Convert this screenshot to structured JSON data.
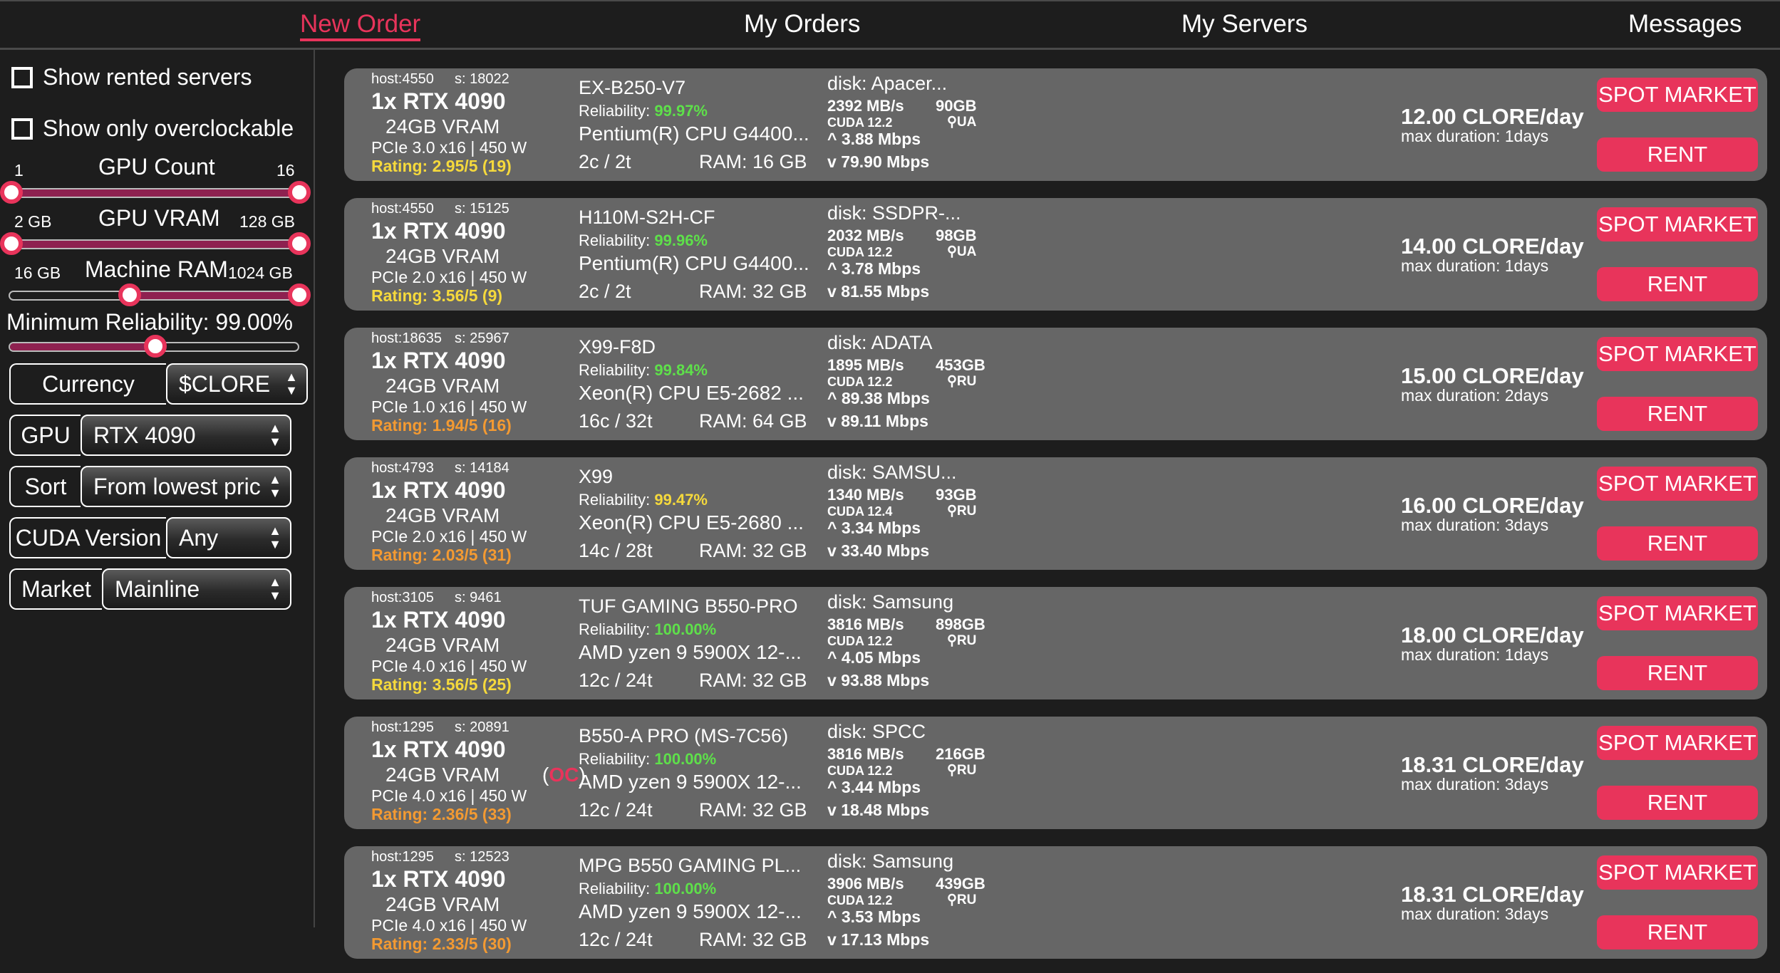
{
  "nav": {
    "items": [
      {
        "label": "New Order",
        "active": true
      },
      {
        "label": "My Orders"
      },
      {
        "label": "My Servers"
      },
      {
        "label": "Messages"
      }
    ]
  },
  "colors": {
    "accent": "#e8345b",
    "card": "#666666",
    "background": "#1d1d1d",
    "green": "#5ee04a",
    "yellow": "#f5d93c",
    "orange": "#f39a32"
  },
  "filters": {
    "show_rented": {
      "label": "Show rented servers",
      "checked": false
    },
    "show_overclockable": {
      "label": "Show only overclockable",
      "checked": false
    },
    "gpu_count": {
      "label": "GPU Count",
      "min_label": "1",
      "max_label": "16",
      "low_fraction": 0,
      "high_fraction": 1
    },
    "gpu_vram": {
      "label": "GPU VRAM",
      "min_label": "2 GB",
      "max_label": "128 GB",
      "low_fraction": 0,
      "high_fraction": 1
    },
    "machine_ram": {
      "label": "Machine RAM",
      "min_label": "16 GB",
      "max_label": "1024 GB",
      "low_fraction": 0.41,
      "high_fraction": 1
    },
    "min_reliability": {
      "label": "Minimum Reliability: 99.00%",
      "fraction": 0.5
    },
    "currency": {
      "label": "Currency",
      "value": "$CLORE"
    },
    "gpu": {
      "label": "GPU",
      "value": "RTX 4090"
    },
    "sort": {
      "label": "Sort",
      "value": "From lowest pric"
    },
    "cuda": {
      "label": "CUDA Version",
      "value": "Any"
    },
    "market": {
      "label": "Market",
      "value": "Mainline"
    }
  },
  "buttons": {
    "spot": "SPOT MARKET",
    "rent": "RENT"
  },
  "servers": [
    {
      "host": "host:4550",
      "s": "s: 18022",
      "gpu": "1x RTX 4090",
      "vram": "24GB VRAM",
      "oc": false,
      "pcie": "PCIe 3.0 x16 | 450 W",
      "rating": "Rating: 2.95/5 (19)",
      "rating_color": "yellow",
      "mb": "EX-B250-V7",
      "reliability": "99.97%",
      "rel_color": "green",
      "cpu": "Pentium(R) CPU G4400...",
      "cores": "2c / 2t",
      "ram": "RAM: 16 GB",
      "disk": "disk: Apacer...",
      "disk_speed": "2392 MB/s",
      "disk_size": "90GB",
      "cuda": "CUDA 12.2",
      "country": "UA",
      "up": "3.88 Mbps",
      "down": "79.90 Mbps",
      "price": "12.00 CLORE/day",
      "duration": "max duration: 1days"
    },
    {
      "host": "host:4550",
      "s": "s: 15125",
      "gpu": "1x RTX 4090",
      "vram": "24GB VRAM",
      "oc": false,
      "pcie": "PCIe 2.0 x16 | 450 W",
      "rating": "Rating: 3.56/5 (9)",
      "rating_color": "yellow",
      "mb": "H110M-S2H-CF",
      "reliability": "99.96%",
      "rel_color": "green",
      "cpu": "Pentium(R) CPU G4400...",
      "cores": "2c / 2t",
      "ram": "RAM: 32 GB",
      "disk": "disk: SSDPR-...",
      "disk_speed": "2032 MB/s",
      "disk_size": "98GB",
      "cuda": "CUDA 12.2",
      "country": "UA",
      "up": "3.78 Mbps",
      "down": "81.55 Mbps",
      "price": "14.00 CLORE/day",
      "duration": "max duration: 1days"
    },
    {
      "host": "host:18635",
      "s": "s: 25967",
      "gpu": "1x RTX 4090",
      "vram": "24GB VRAM",
      "oc": false,
      "pcie": "PCIe 1.0 x16 | 450 W",
      "rating": "Rating: 1.94/5 (16)",
      "rating_color": "orange",
      "mb": "X99-F8D",
      "reliability": "99.84%",
      "rel_color": "green",
      "cpu": "Xeon(R) CPU E5-2682 ...",
      "cores": "16c / 32t",
      "ram": "RAM: 64 GB",
      "disk": "disk: ADATA",
      "disk_speed": "1895 MB/s",
      "disk_size": "453GB",
      "cuda": "CUDA 12.2",
      "country": "RU",
      "up": "89.38 Mbps",
      "down": "89.11 Mbps",
      "price": "15.00 CLORE/day",
      "duration": "max duration: 2days"
    },
    {
      "host": "host:4793",
      "s": "s: 14184",
      "gpu": "1x RTX 4090",
      "vram": "24GB VRAM",
      "oc": false,
      "pcie": "PCIe 2.0 x16 | 450 W",
      "rating": "Rating: 2.03/5 (31)",
      "rating_color": "orange",
      "mb": "X99",
      "reliability": "99.47%",
      "rel_color": "yellow",
      "cpu": "Xeon(R) CPU E5-2680 ...",
      "cores": "14c / 28t",
      "ram": "RAM: 32 GB",
      "disk": "disk: SAMSU...",
      "disk_speed": "1340 MB/s",
      "disk_size": "93GB",
      "cuda": "CUDA 12.4",
      "country": "RU",
      "up": "3.34 Mbps",
      "down": "33.40 Mbps",
      "price": "16.00 CLORE/day",
      "duration": "max duration: 3days"
    },
    {
      "host": "host:3105",
      "s": "s: 9461",
      "gpu": "1x RTX 4090",
      "vram": "24GB VRAM",
      "oc": false,
      "pcie": "PCIe 4.0 x16 | 450 W",
      "rating": "Rating: 3.56/5 (25)",
      "rating_color": "yellow",
      "mb": "TUF GAMING B550-PRO",
      "reliability": "100.00%",
      "rel_color": "green",
      "cpu": "AMD yzen 9 5900X 12-...",
      "cores": "12c / 24t",
      "ram": "RAM: 32 GB",
      "disk": "disk: Samsung",
      "disk_speed": "3816 MB/s",
      "disk_size": "898GB",
      "cuda": "CUDA 12.2",
      "country": "RU",
      "up": "4.05 Mbps",
      "down": "93.88 Mbps",
      "price": "18.00 CLORE/day",
      "duration": "max duration: 1days"
    },
    {
      "host": "host:1295",
      "s": "s: 20891",
      "gpu": "1x RTX 4090",
      "vram": "24GB VRAM",
      "oc": true,
      "oc_label": "OC",
      "pcie": "PCIe 4.0 x16 | 450 W",
      "rating": "Rating: 2.36/5 (33)",
      "rating_color": "orange",
      "mb": "B550-A PRO (MS-7C56)",
      "reliability": "100.00%",
      "rel_color": "green",
      "cpu": "AMD yzen 9 5900X 12-...",
      "cores": "12c / 24t",
      "ram": "RAM: 32 GB",
      "disk": "disk: SPCC",
      "disk_speed": "3816 MB/s",
      "disk_size": "216GB",
      "cuda": "CUDA 12.2",
      "country": "RU",
      "up": "3.44 Mbps",
      "down": "18.48 Mbps",
      "price": "18.31 CLORE/day",
      "duration": "max duration: 3days"
    },
    {
      "host": "host:1295",
      "s": "s: 12523",
      "gpu": "1x RTX 4090",
      "vram": "24GB VRAM",
      "oc": false,
      "pcie": "PCIe 4.0 x16 | 450 W",
      "rating": "Rating: 2.33/5 (30)",
      "rating_color": "orange",
      "mb": "MPG B550 GAMING PL...",
      "reliability": "100.00%",
      "rel_color": "green",
      "cpu": "AMD yzen 9 5900X 12-...",
      "cores": "12c / 24t",
      "ram": "RAM: 32 GB",
      "disk": "disk: Samsung",
      "disk_speed": "3906 MB/s",
      "disk_size": "439GB",
      "cuda": "CUDA 12.2",
      "country": "RU",
      "up": "3.53 Mbps",
      "down": "17.13 Mbps",
      "price": "18.31 CLORE/day",
      "duration": "max duration: 3days"
    }
  ]
}
